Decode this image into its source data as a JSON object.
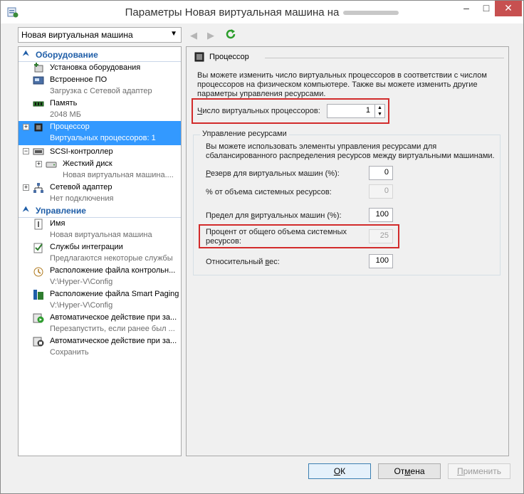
{
  "window": {
    "title": "Параметры Новая виртуальная машина на",
    "controls": {
      "minimize": "–",
      "maximize": "□",
      "close": "✕"
    }
  },
  "toolbar": {
    "vm_selector": "Новая виртуальная машина",
    "icons": [
      "arrow-left-icon",
      "arrow-right-icon",
      "refresh-icon"
    ]
  },
  "sidebar": {
    "hardware_header": "Оборудование",
    "management_header": "Управление",
    "hardware_items": [
      {
        "label": "Установка оборудования",
        "sub": "",
        "icon": "add-hardware-icon"
      },
      {
        "label": "Встроенное ПО",
        "sub": "Загрузка с Сетевой адаптер",
        "icon": "firmware-icon"
      },
      {
        "label": "Память",
        "sub": "2048 МБ",
        "icon": "memory-icon"
      },
      {
        "label": "Процессор",
        "sub": "Виртуальных процессоров: 1",
        "icon": "processor-icon",
        "selected": true
      },
      {
        "label": "SCSI-контроллер",
        "sub": "",
        "icon": "scsi-icon"
      },
      {
        "label": "Жесткий диск",
        "sub": "Новая виртуальная машина....",
        "icon": "hard-disk-icon"
      },
      {
        "label": "Сетевой адаптер",
        "sub": "Нет подключения",
        "icon": "network-adapter-icon"
      }
    ],
    "management_items": [
      {
        "label": "Имя",
        "sub": "Новая виртуальная машина",
        "icon": "name-icon"
      },
      {
        "label": "Службы интеграции",
        "sub": "Предлагаются некоторые службы",
        "icon": "integration-services-icon"
      },
      {
        "label": "Расположение файла контрольн...",
        "sub": "V:\\Hyper-V\\Config",
        "icon": "checkpoint-location-icon"
      },
      {
        "label": "Расположение файла Smart Paging",
        "sub": "V:\\Hyper-V\\Config",
        "icon": "smart-paging-icon"
      },
      {
        "label": "Автоматическое действие при за...",
        "sub": "Перезапустить, если ранее был ...",
        "icon": "autostart-icon"
      },
      {
        "label": "Автоматическое действие при за...",
        "sub": "Сохранить",
        "icon": "autostop-icon"
      }
    ]
  },
  "main": {
    "section_title": "Процессор",
    "intro": "Вы можете изменить число виртуальных процессоров в соответствии с числом процессоров на физическом компьютере. Также вы можете изменить другие параметры управления ресурсами.",
    "vcpu_label_u": "Ч",
    "vcpu_label_rest": "исло виртуальных процессоров:",
    "vcpu_value": "1",
    "resource": {
      "title": "Управление ресурсами",
      "description": "Вы можете использовать элементы управления ресурсами для сбалансированного распределения ресурсов между виртуальными машинами.",
      "reserve_label_u": "Р",
      "reserve_label_rest": "езерв для виртуальных машин (%):",
      "reserve_value": "0",
      "reserve_pct_label": "% от объема системных ресурсов:",
      "reserve_pct_value": "0",
      "limit_label_pre": "Предел для ",
      "limit_label_u": "в",
      "limit_label_rest": "иртуальных машин (%):",
      "limit_value": "100",
      "limit_pct_label": "Процент от общего объема системных ресурсов:",
      "limit_pct_value": "25",
      "weight_label_pre": "Относительный ",
      "weight_label_u": "в",
      "weight_label_rest": "ес:",
      "weight_value": "100"
    }
  },
  "buttons": {
    "ok_u": "О",
    "ok_rest": "К",
    "cancel_pre": "От",
    "cancel_u": "м",
    "cancel_rest": "ена",
    "apply_pre": "",
    "apply_u": "П",
    "apply_rest": "рименить"
  },
  "colors": {
    "selection": "#3399ff",
    "section_header": "#1f5ea8",
    "highlight_box": "#d22b2b"
  }
}
